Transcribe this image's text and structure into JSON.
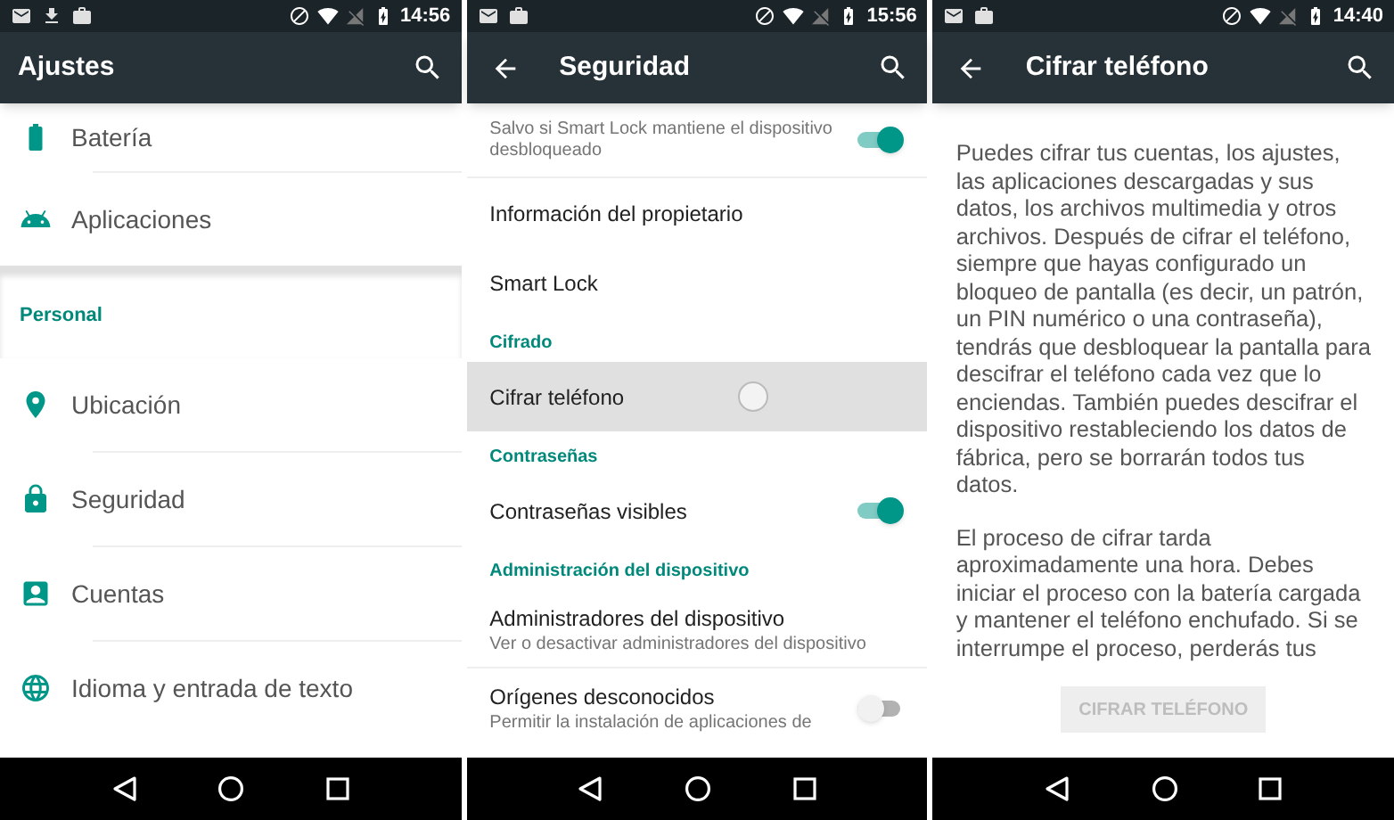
{
  "panels": [
    {
      "status_bar": {
        "notifications": [
          {
            "kind": "mail"
          },
          {
            "kind": "download"
          },
          {
            "kind": "briefcase"
          }
        ],
        "time": "14:56"
      },
      "app_bar": {
        "title": "Ajustes",
        "back": false
      },
      "settings": [
        {
          "kind": "item",
          "label": "Batería"
        },
        {
          "kind": "item",
          "label": "Aplicaciones"
        },
        {
          "kind": "section",
          "label": "Personal"
        },
        {
          "kind": "item",
          "label": "Ubicación"
        },
        {
          "kind": "item",
          "label": "Seguridad"
        },
        {
          "kind": "item",
          "label": "Cuentas"
        },
        {
          "kind": "item",
          "label": "Idioma y entrada de texto"
        }
      ]
    },
    {
      "status_bar": {
        "notifications": [
          {
            "kind": "mail"
          },
          {
            "kind": "briefcase"
          }
        ],
        "time": "15:56"
      },
      "app_bar": {
        "title": "Seguridad",
        "back": true
      },
      "preferences": [
        {
          "kind": "item",
          "summary": "Salvo si Smart Lock mantiene el dispositivo desbloqueado",
          "on": true,
          "selected": false
        },
        {
          "kind": "item",
          "title": "Información del propietario",
          "selected": false
        },
        {
          "kind": "item",
          "title": "Smart Lock",
          "selected": false
        },
        {
          "kind": "header",
          "title": "Cifrado",
          "selected": false
        },
        {
          "kind": "item",
          "title": "Cifrar teléfono",
          "selected": true
        },
        {
          "kind": "header",
          "title": "Contraseñas",
          "selected": false
        },
        {
          "kind": "item",
          "title": "Contraseñas visibles",
          "on": true,
          "selected": false
        },
        {
          "kind": "header",
          "title": "Administración del dispositivo",
          "selected": false
        },
        {
          "kind": "item",
          "title": "Administradores del dispositivo",
          "summary": "Ver o desactivar administradores del dispositivo",
          "selected": false
        },
        {
          "kind": "item",
          "title": "Orígenes desconocidos",
          "summary": "Permitir la instalación de aplicaciones de",
          "on": false,
          "selected": false
        }
      ]
    },
    {
      "status_bar": {
        "notifications": [
          {
            "kind": "mail"
          },
          {
            "kind": "briefcase"
          }
        ],
        "time": "14:40"
      },
      "app_bar": {
        "title": "Cifrar teléfono",
        "back": true
      },
      "paragraphs": [
        "Puedes cifrar tus cuentas, los ajustes, las aplicaciones descargadas y sus datos, los archivos multimedia y otros archivos. Después de cifrar el teléfono, siempre que hayas configurado un bloqueo de pantalla (es decir, un patrón, un PIN numérico o una contraseña), tendrás que desbloquear la pantalla para descifrar el teléfono cada vez que lo enciendas. También puedes descifrar el dispositivo restableciendo los datos de fábrica, pero se borrarán todos tus datos.",
        "El proceso de cifrar tarda aproximadamente una hora. Debes iniciar el proceso con la batería cargada y mantener el teléfono enchufado. Si se interrumpe el proceso, perderás tus"
      ],
      "button": {
        "label": "CIFRAR TELÉFONO",
        "disabled": true
      }
    }
  ]
}
